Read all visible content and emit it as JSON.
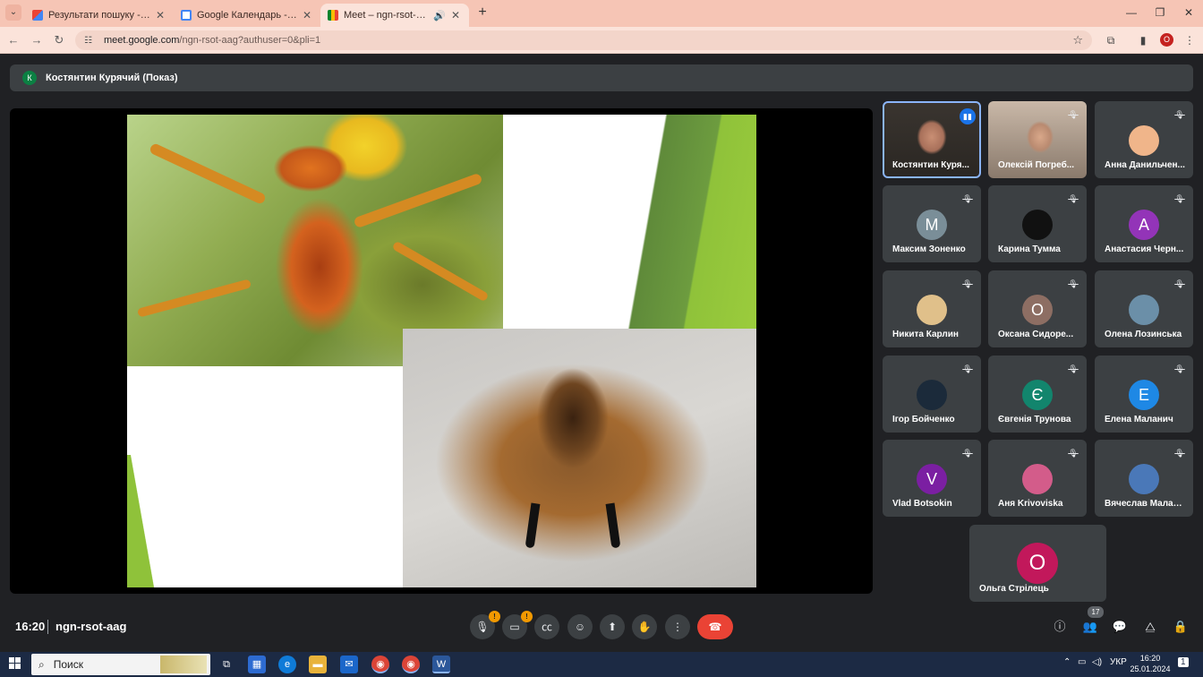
{
  "browser": {
    "tabs": [
      {
        "title": "Результати пошуку - olhastrile",
        "favicon": "gmail-icon",
        "active": false
      },
      {
        "title": "Google Календарь - сентябрь",
        "favicon": "calendar-icon",
        "active": false
      },
      {
        "title": "Meet – ngn-rsot-aag",
        "favicon": "meet-icon",
        "active": true
      }
    ],
    "url_host": "meet.google.com",
    "url_path": "/ngn-rsot-aag?authuser=0&pli=1",
    "profile_letter": "O"
  },
  "meet": {
    "presenter": {
      "initial": "К",
      "name": "Костянтин Курячий (Показ)"
    },
    "participants": [
      {
        "name": "Костянтин Куря...",
        "type": "video",
        "speaking": true
      },
      {
        "name": "Олексій Погреб...",
        "type": "video",
        "speaking": false
      },
      {
        "name": "Анна Данильчен...",
        "type": "photo",
        "color": "#f0b58a"
      },
      {
        "name": "Максим Зоненко",
        "type": "letter",
        "initial": "M",
        "color": "#7a8e98"
      },
      {
        "name": "Карина Тумма",
        "type": "photo",
        "color": "#111111"
      },
      {
        "name": "Анастасия Черн...",
        "type": "letter",
        "initial": "A",
        "color": "#9334b8"
      },
      {
        "name": "Никита Карлин",
        "type": "photo",
        "color": "#e0c08a"
      },
      {
        "name": "Оксана Сидоре...",
        "type": "letter",
        "initial": "О",
        "color": "#8d6e63"
      },
      {
        "name": "Олена Лозинська",
        "type": "photo",
        "color": "#6b8fa8"
      },
      {
        "name": "Ігор Бойченко",
        "type": "photo",
        "color": "#1b2a3a"
      },
      {
        "name": "Євгенія Трунова",
        "type": "letter",
        "initial": "Є",
        "color": "#12856d"
      },
      {
        "name": "Елена Маланич",
        "type": "letter",
        "initial": "Е",
        "color": "#1e88e5"
      },
      {
        "name": "Vlad Botsokin",
        "type": "letter",
        "initial": "V",
        "color": "#7b1fa2"
      },
      {
        "name": "Аня Krivoviska",
        "type": "photo",
        "color": "#d35c8a"
      },
      {
        "name": "Вячеслав Малан...",
        "type": "photo",
        "color": "#4a78b8"
      }
    ],
    "last_participant": {
      "name": "Ольга Стрілець",
      "initial": "О",
      "color": "#c2185b"
    },
    "time": "16:20",
    "meeting_code": "ngn-rsot-aag",
    "warning_badge": "!",
    "people_count": "17"
  },
  "taskbar": {
    "search_placeholder": "Поиск",
    "language": "УКР",
    "time": "16:20",
    "date": "25.01.2024",
    "notification_count": "1"
  }
}
